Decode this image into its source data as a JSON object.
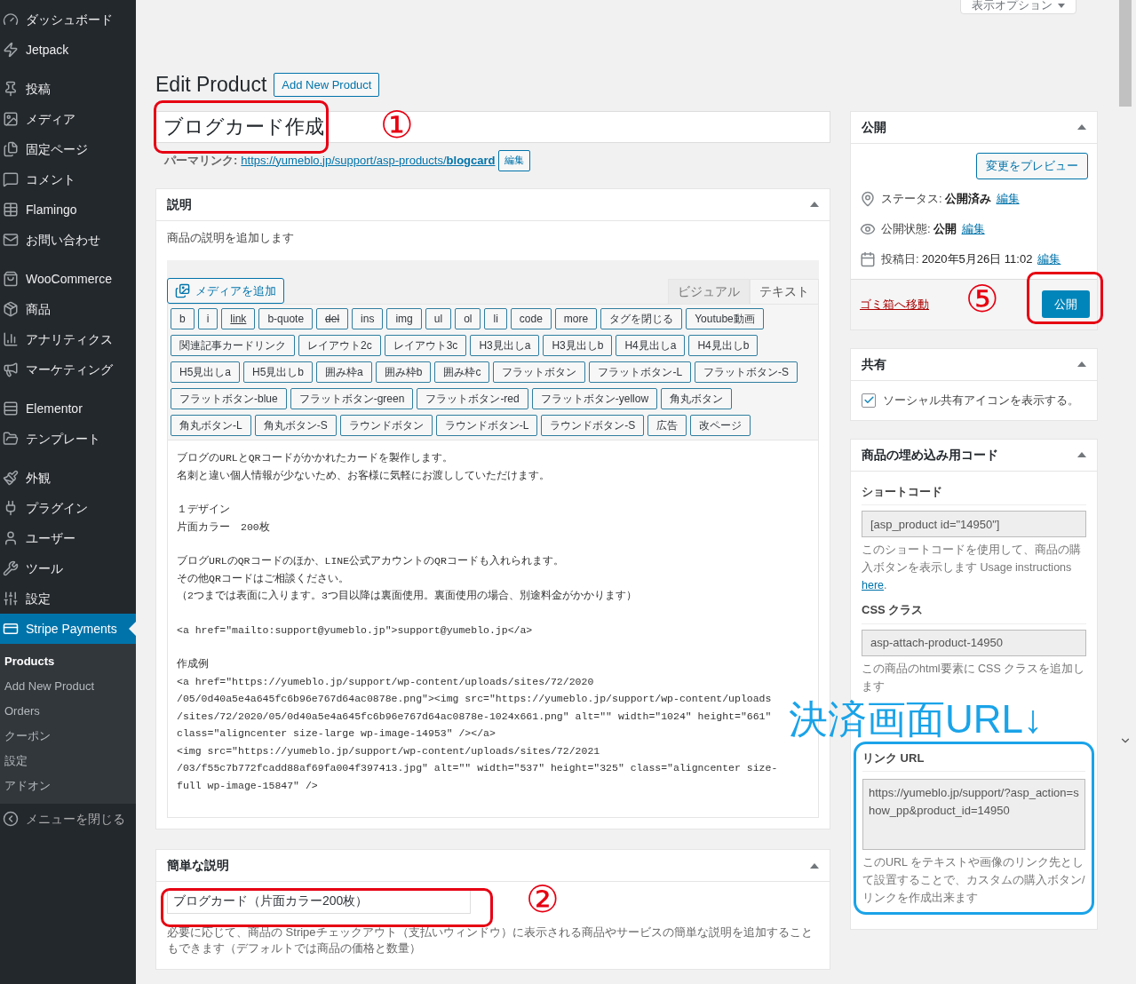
{
  "screen_options": {
    "label": "表示オプション"
  },
  "admin_menu": {
    "groups": [
      [
        {
          "label": "ダッシュボード",
          "selected": false
        },
        {
          "label": "Jetpack",
          "selected": false
        }
      ],
      [
        {
          "label": "投稿",
          "selected": false
        },
        {
          "label": "メディア",
          "selected": false
        },
        {
          "label": "固定ページ",
          "selected": false
        },
        {
          "label": "コメント",
          "selected": false
        },
        {
          "label": "Flamingo",
          "selected": false
        },
        {
          "label": "お問い合わせ",
          "selected": false
        }
      ],
      [
        {
          "label": "WooCommerce",
          "selected": false
        },
        {
          "label": "商品",
          "selected": false
        },
        {
          "label": "アナリティクス",
          "selected": false
        },
        {
          "label": "マーケティング",
          "selected": false
        }
      ],
      [
        {
          "label": "Elementor",
          "selected": false
        },
        {
          "label": "テンプレート",
          "selected": false
        }
      ],
      [
        {
          "label": "外観",
          "selected": false
        },
        {
          "label": "プラグイン",
          "selected": false
        },
        {
          "label": "ユーザー",
          "selected": false
        },
        {
          "label": "ツール",
          "selected": false
        },
        {
          "label": "設定",
          "selected": false
        },
        {
          "label": "Stripe Payments",
          "selected": true
        }
      ]
    ],
    "submenu": [
      {
        "label": "Products",
        "selected": true
      },
      {
        "label": "Add New Product",
        "selected": false
      },
      {
        "label": "Orders",
        "selected": false
      },
      {
        "label": "クーポン",
        "selected": false
      },
      {
        "label": "設定",
        "selected": false
      },
      {
        "label": "アドオン",
        "selected": false
      }
    ],
    "collapse": "メニューを閉じる"
  },
  "page": {
    "title": "Edit Product",
    "add_new": "Add New Product"
  },
  "title_field": {
    "value": "ブログカード作成"
  },
  "permalink": {
    "label": "パーマリンク:",
    "url": "https://yumeblo.jp/support/asp-products/**blogcard**",
    "edit": "編集"
  },
  "description": {
    "title": "説明",
    "hint": "商品の説明を追加します",
    "media_button": "メディアを追加",
    "tabs": [
      {
        "label": "ビジュアル",
        "selected": false
      },
      {
        "label": "テキスト",
        "selected": true
      }
    ],
    "quicktags": [
      {
        "label": "b",
        "kind": "plain"
      },
      {
        "label": "i",
        "kind": "plain"
      },
      {
        "label": "link",
        "kind": "underline"
      },
      {
        "label": "b-quote",
        "kind": "plain"
      },
      {
        "label": "del",
        "kind": "strike"
      },
      {
        "label": "ins",
        "kind": "plain"
      },
      {
        "label": "img",
        "kind": "plain"
      },
      {
        "label": "ul",
        "kind": "plain"
      },
      {
        "label": "ol",
        "kind": "plain"
      },
      {
        "label": "li",
        "kind": "plain"
      },
      {
        "label": "code",
        "kind": "plain"
      },
      {
        "label": "more",
        "kind": "plain"
      },
      {
        "label": "タグを閉じる",
        "kind": "plain"
      },
      {
        "label": "Youtube動画",
        "kind": "plain"
      },
      {
        "label": "関連記事カードリンク",
        "kind": "plain"
      },
      {
        "label": "レイアウト2c",
        "kind": "plain"
      },
      {
        "label": "レイアウト3c",
        "kind": "plain"
      },
      {
        "label": "H3見出しa",
        "kind": "plain"
      },
      {
        "label": "H3見出しb",
        "kind": "plain"
      },
      {
        "label": "H4見出しa",
        "kind": "plain"
      },
      {
        "label": "H4見出しb",
        "kind": "plain"
      },
      {
        "label": "H5見出しa",
        "kind": "plain"
      },
      {
        "label": "H5見出しb",
        "kind": "plain"
      },
      {
        "label": "囲み枠a",
        "kind": "plain"
      },
      {
        "label": "囲み枠b",
        "kind": "plain"
      },
      {
        "label": "囲み枠c",
        "kind": "plain"
      },
      {
        "label": "フラットボタン",
        "kind": "plain"
      },
      {
        "label": "フラットボタン-L",
        "kind": "plain"
      },
      {
        "label": "フラットボタン-S",
        "kind": "plain"
      },
      {
        "label": "フラットボタン-blue",
        "kind": "plain"
      },
      {
        "label": "フラットボタン-green",
        "kind": "plain"
      },
      {
        "label": "フラットボタン-red",
        "kind": "plain"
      },
      {
        "label": "フラットボタン-yellow",
        "kind": "plain"
      },
      {
        "label": "角丸ボタン",
        "kind": "plain"
      },
      {
        "label": "角丸ボタン-L",
        "kind": "plain"
      },
      {
        "label": "角丸ボタン-S",
        "kind": "plain"
      },
      {
        "label": "ラウンドボタン",
        "kind": "plain"
      },
      {
        "label": "ラウンドボタン-L",
        "kind": "plain"
      },
      {
        "label": "ラウンドボタン-S",
        "kind": "plain"
      },
      {
        "label": "広告",
        "kind": "plain"
      },
      {
        "label": "改ページ",
        "kind": "plain"
      }
    ],
    "content": [
      [
        "ブログのURLとQRコードがかかれたカードを製作します。",
        "名刺と違い個人情報が少ないため、お客様に気軽にお渡ししていただけます。"
      ],
      [
        "１デザイン",
        "片面カラー　200枚"
      ],
      [
        "ブログURLのQRコードのほか、LINE公式アカウントのQRコードも入れられます。",
        "その他QRコードはご相談ください。",
        "（2つまでは表面に入ります。3つ目以降は裏面使用。裏面使用の場合、別途料金がかかります）"
      ],
      [
        "<a href=\"mailto:support@yumeblo.jp\">support@yumeblo.jp</a>"
      ],
      [
        "作成例",
        "<a href=\"https://yumeblo.jp/support/wp-content/uploads/sites/72/2020",
        "/05/0d40a5e4a645fc6b96e767d64ac0878e.png\"><img src=\"https://yumeblo.jp/support/wp-content/uploads",
        "/sites/72/2020/05/0d40a5e4a645fc6b96e767d64ac0878e-1024x661.png\" alt=\"\" width=\"1024\" height=\"661\"",
        "class=\"aligncenter size-large wp-image-14953\" /></a>",
        "<img src=\"https://yumeblo.jp/support/wp-content/uploads/sites/72/2021",
        "/03/f55c7b772fcadd88af69fa004f397413.jpg\" alt=\"\" width=\"537\" height=\"325\" class=\"aligncenter size-",
        "full wp-image-15847\" />"
      ]
    ]
  },
  "short_description": {
    "title": "簡単な説明",
    "value": "ブログカード（片面カラー200枚）",
    "help": "必要に応じて、商品の Stripeチェックアウト（支払いウィンドウ）に表示される商品やサービスの簡単な説明を追加することもできます（デフォルトでは商品の価格と数量）"
  },
  "publish": {
    "title": "公開",
    "preview": "変更をプレビュー",
    "rows": [
      {
        "label": "ステータス:",
        "value": "公開済み",
        "value_bold": true,
        "edit": "編集"
      },
      {
        "label": "公開状態:",
        "value": "公開",
        "value_bold": true,
        "edit": "編集"
      },
      {
        "label": "投稿日:",
        "value": "2020年5月26日 11:02",
        "value_bold": false,
        "edit": "編集"
      }
    ],
    "trash": "ゴミ箱へ移動",
    "button": "公開"
  },
  "share": {
    "title": "共有",
    "checkbox": {
      "label": "ソーシャル共有アイコンを表示する。",
      "checked": true
    }
  },
  "embed": {
    "title": "商品の埋め込み用コード",
    "shortcode": {
      "label": "ショートコード",
      "value": "[asp_product id=\"14950\"]",
      "help": "このショートコードを使用して、商品の購入ボタンを表示します Usage instructions",
      "link": "here",
      "after": "."
    },
    "css": {
      "label": "CSS クラス",
      "value": "asp-attach-product-14950",
      "help": "この商品のhtml要素に CSS クラスを追加します"
    },
    "link_url": {
      "label": "リンク URL",
      "value": "https://yumeblo.jp/support/?asp_action=show_pp&product_id=14950",
      "help": "このURL をテキストや画像のリンク先として設置することで、カスタムの購入ボタン/リンクを作成出来ます"
    }
  },
  "annotations": [
    {
      "kind": "number",
      "label": "①"
    },
    {
      "kind": "number",
      "label": "②"
    },
    {
      "kind": "number",
      "label": "⑤"
    },
    {
      "kind": "caption",
      "label": "決済画面URL↓"
    }
  ]
}
